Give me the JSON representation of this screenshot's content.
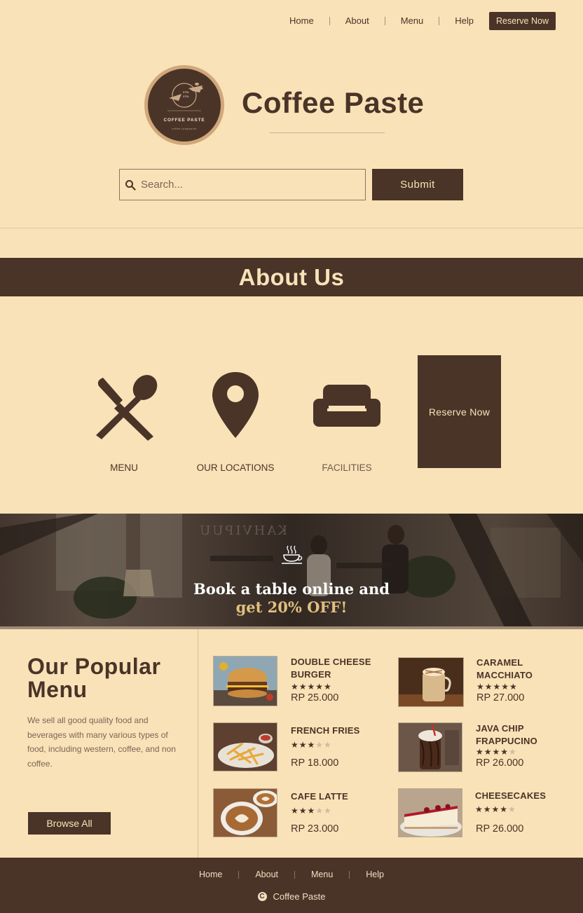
{
  "nav": {
    "items": [
      "Home",
      "About",
      "Menu",
      "Help"
    ],
    "reserve_label": "Reserve Now"
  },
  "brand": {
    "title": "Coffee Paste",
    "logo_text": "COFFEE PASTE",
    "logo_sub": "coffee companion"
  },
  "search": {
    "placeholder": "Search...",
    "submit_label": "Submit"
  },
  "about": {
    "title": "About Us",
    "features": [
      {
        "label": "MENU",
        "icon": "utensils-icon"
      },
      {
        "label": "OUR LOCATIONS",
        "icon": "map-pin-icon"
      },
      {
        "label": "FACILITIES",
        "icon": "sofa-icon"
      }
    ],
    "reserve_label": "Reserve Now"
  },
  "banner": {
    "line1": "Book a table online and",
    "line2": "get 20% OFF!",
    "sign_text": "KAHVIPUU"
  },
  "popular": {
    "title": "Our Popular Menu",
    "description": "We sell all good quality food and beverages with many various types of food, including western, coffee, and non coffee.",
    "browse_label": "Browse All",
    "items": [
      {
        "name": "DOUBLE CHEESE BURGER",
        "rating": 5,
        "price": "RP 25.000"
      },
      {
        "name": "CARAMEL MACCHIATO",
        "rating": 5,
        "price": "RP 27.000"
      },
      {
        "name": "FRENCH FRIES",
        "rating": 3,
        "price": "RP 18.000"
      },
      {
        "name": "JAVA CHIP FRAPPUCINO",
        "rating": 4,
        "price": "RP 26.000"
      },
      {
        "name": "CAFE LATTE",
        "rating": 3,
        "price": "RP 23.000"
      },
      {
        "name": "CHEESECAKES",
        "rating": 4,
        "price": "RP 26.000"
      }
    ]
  },
  "footer": {
    "items": [
      "Home",
      "About",
      "Menu",
      "Help"
    ],
    "brand": "Coffee Paste"
  },
  "colors": {
    "background": "#f9e2b7",
    "primary": "#4a3428",
    "accent": "#e2bf7f"
  }
}
